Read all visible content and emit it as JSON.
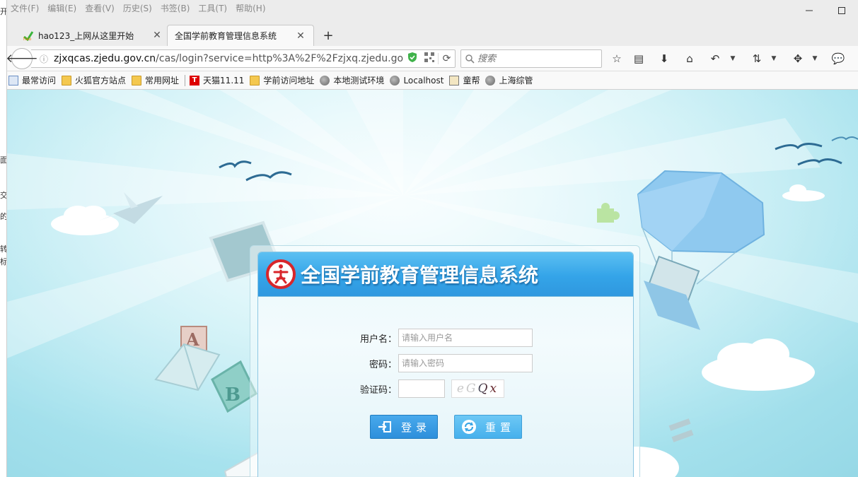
{
  "background_window": {
    "fragments": [
      "开",
      "面",
      "交",
      "的",
      "转",
      "标"
    ]
  },
  "menubar": {
    "items": [
      "文件(F)",
      "编辑(E)",
      "查看(V)",
      "历史(S)",
      "书签(B)",
      "工具(T)",
      "帮助(H)"
    ]
  },
  "tabs": [
    {
      "title": "hao123_上网从这里开始",
      "active": false
    },
    {
      "title": "全国学前教育管理信息系统",
      "active": true
    }
  ],
  "navbar": {
    "url_host": "zjxqcas.zjedu.gov.cn",
    "url_path": "/cas/login?service=http%3A%2F%2Fzjxq.zjedu.go",
    "search_placeholder": "搜索"
  },
  "bookmarks": [
    {
      "label": "最常访问",
      "icon": "most-visited-icon"
    },
    {
      "label": "火狐官方站点",
      "icon": "folder-icon"
    },
    {
      "label": "常用网址",
      "icon": "folder-icon"
    },
    {
      "label": "天猫11.11",
      "icon": "tmall-icon"
    },
    {
      "label": "学前访问地址",
      "icon": "folder-icon"
    },
    {
      "label": "本地测试环境",
      "icon": "globe-icon"
    },
    {
      "label": "Localhost",
      "icon": "globe-icon"
    },
    {
      "label": "童帮",
      "icon": "image-icon"
    },
    {
      "label": "上海综管",
      "icon": "globe-icon"
    }
  ],
  "login": {
    "title": "全国学前教育管理信息系统",
    "username_label": "用户名：",
    "username_placeholder": "请输入用户名",
    "password_label": "密码：",
    "password_placeholder": "请输入密码",
    "captcha_label": "验证码：",
    "captcha_text": "eGQx",
    "login_button": "登录",
    "reset_button": "重置"
  },
  "colors": {
    "header_blue": "#34a4e8",
    "login_button": "#2d8fdb",
    "reset_button": "#46b0ec",
    "logo_red": "#d8262b"
  }
}
